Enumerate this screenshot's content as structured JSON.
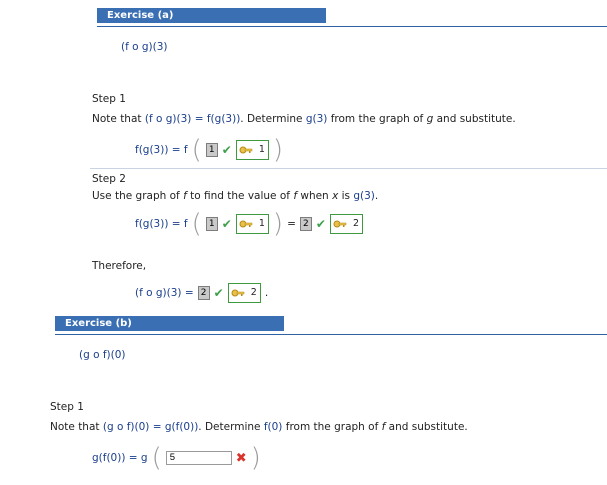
{
  "exercise_a": {
    "title": "Exercise (a)",
    "expression": "(f o g)(3)",
    "step1": {
      "label": "Step 1",
      "text_prefix": "Note that ",
      "text_expr": "(f o g)(3) = f(g(3))",
      "text_mid": ". Determine ",
      "text_expr2": "g(3)",
      "text_mid2": " from the graph of ",
      "text_var": "g",
      "text_suffix": " and substitute.",
      "formula_lhs": "f(g(3)) = f",
      "answer": "1",
      "key_value": "1"
    },
    "step2": {
      "label": "Step 2",
      "text_prefix": "Use the graph of ",
      "text_var": "f",
      "text_mid": " to find the value of ",
      "text_var2": "f",
      "text_mid2": " when ",
      "text_var3": "x",
      "text_mid3": " is ",
      "text_expr": "g(3)",
      "text_suffix": ".",
      "formula_lhs": "f(g(3)) = f",
      "inner_answer": "1",
      "inner_key": "1",
      "eq": "=",
      "outer_answer": "2",
      "outer_key": "2"
    },
    "therefore": {
      "label": "Therefore,",
      "formula_lhs": "(f o g)(3) =",
      "answer": "2",
      "key_value": "2",
      "period": "."
    }
  },
  "exercise_b": {
    "title": "Exercise (b)",
    "expression": "(g o f)(0)",
    "step1": {
      "label": "Step 1",
      "text_prefix": "Note that ",
      "text_expr": "(g o f)(0) = g(f(0))",
      "text_mid": ". Determine ",
      "text_expr2": "f(0)",
      "text_mid2": " from the graph of ",
      "text_var": "f",
      "text_suffix": " and substitute.",
      "formula_lhs": "g(f(0)) = g",
      "input_value": "5"
    }
  },
  "colors": {
    "header_bg": "#3a6fb3",
    "check": "#3ea04a",
    "cross": "#d9342b",
    "key_border": "#3f9a3f"
  },
  "icons": {
    "correct": "check-icon",
    "incorrect": "cross-icon",
    "key": "key-icon"
  }
}
